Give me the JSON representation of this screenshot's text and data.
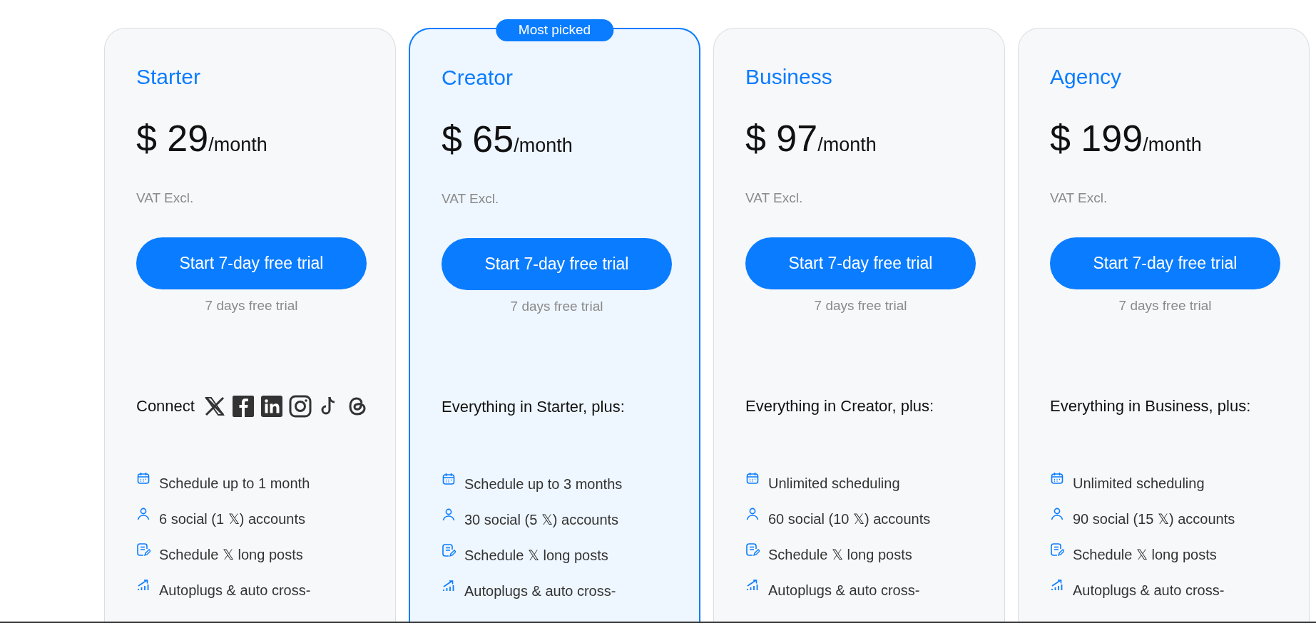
{
  "plans": [
    {
      "name": "Starter",
      "featured": false,
      "price": "$ 29",
      "period": "/month",
      "vat": "VAT Excl.",
      "button": "Start 7-day free trial",
      "note": "7 days free trial",
      "intro": {
        "kind": "connect",
        "text": "Connect"
      },
      "features": [
        {
          "kind": "calendar",
          "text": "Schedule up to 1 month"
        },
        {
          "kind": "user",
          "text": "6 social (1 𝕏) accounts"
        },
        {
          "kind": "post",
          "text": "Schedule 𝕏 long posts"
        },
        {
          "kind": "chart",
          "text": "Autoplugs & auto cross-"
        }
      ]
    },
    {
      "name": "Creator",
      "featured": true,
      "badge": "Most picked",
      "price": "$ 65",
      "period": "/month",
      "vat": "VAT Excl.",
      "button": "Start 7-day free trial",
      "note": "7 days free trial",
      "intro": {
        "kind": "text",
        "text": "Everything in Starter, plus:"
      },
      "features": [
        {
          "kind": "calendar",
          "text": "Schedule up to 3 months"
        },
        {
          "kind": "user",
          "text": "30 social (5 𝕏) accounts"
        },
        {
          "kind": "post",
          "text": "Schedule 𝕏 long posts"
        },
        {
          "kind": "chart",
          "text": "Autoplugs & auto cross-"
        }
      ]
    },
    {
      "name": "Business",
      "featured": false,
      "price": "$ 97",
      "period": "/month",
      "vat": "VAT Excl.",
      "button": "Start 7-day free trial",
      "note": "7 days free trial",
      "intro": {
        "kind": "text",
        "text": "Everything in Creator, plus:"
      },
      "features": [
        {
          "kind": "calendar",
          "text": "Unlimited scheduling"
        },
        {
          "kind": "user",
          "text": "60 social (10 𝕏) accounts"
        },
        {
          "kind": "post",
          "text": "Schedule 𝕏 long posts"
        },
        {
          "kind": "chart",
          "text": "Autoplugs & auto cross-"
        }
      ]
    },
    {
      "name": "Agency",
      "featured": false,
      "price": "$ 199",
      "period": "/month",
      "vat": "VAT Excl.",
      "button": "Start 7-day free trial",
      "note": "7 days free trial",
      "intro": {
        "kind": "text",
        "text": "Everything in Business, plus:"
      },
      "features": [
        {
          "kind": "calendar",
          "text": "Unlimited scheduling"
        },
        {
          "kind": "user",
          "text": "90 social (15 𝕏) accounts"
        },
        {
          "kind": "post",
          "text": "Schedule 𝕏 long posts"
        },
        {
          "kind": "chart",
          "text": "Autoplugs & auto cross-"
        }
      ]
    }
  ]
}
